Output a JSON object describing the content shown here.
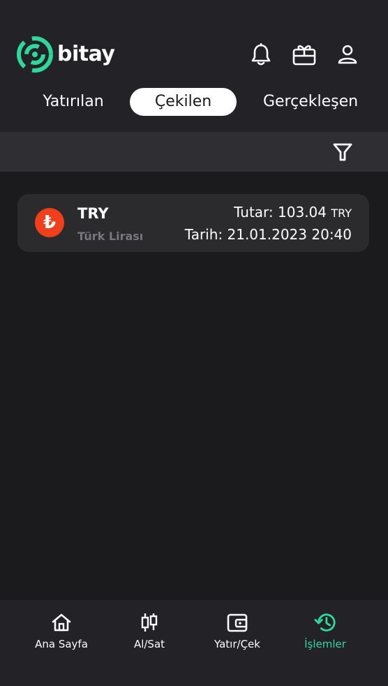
{
  "brand": {
    "name": "bitay",
    "accent": "#2fd89a"
  },
  "header": {
    "icons": [
      "bell-icon",
      "gift-icon",
      "user-icon"
    ]
  },
  "tabs": [
    {
      "label": "Yatırılan",
      "active": false
    },
    {
      "label": "Çekilen",
      "active": true
    },
    {
      "label": "Gerçekleşen",
      "active": false
    }
  ],
  "filter": {
    "icon": "filter-icon"
  },
  "transactions": [
    {
      "code": "TRY",
      "name": "Türk Lirası",
      "symbol": "₺",
      "amount_label": "Tutar: 103.04",
      "amount_unit": "TRY",
      "date_label": "Tarih: 21.01.2023 20:40",
      "icon_color": "#f0401b"
    }
  ],
  "bottom_nav": [
    {
      "label": "Ana Sayfa",
      "icon": "home-icon",
      "active": false
    },
    {
      "label": "Al/Sat",
      "icon": "candlestick-icon",
      "active": false
    },
    {
      "label": "Yatır/Çek",
      "icon": "wallet-icon",
      "active": false
    },
    {
      "label": "İşlemler",
      "icon": "history-icon",
      "active": true
    }
  ]
}
